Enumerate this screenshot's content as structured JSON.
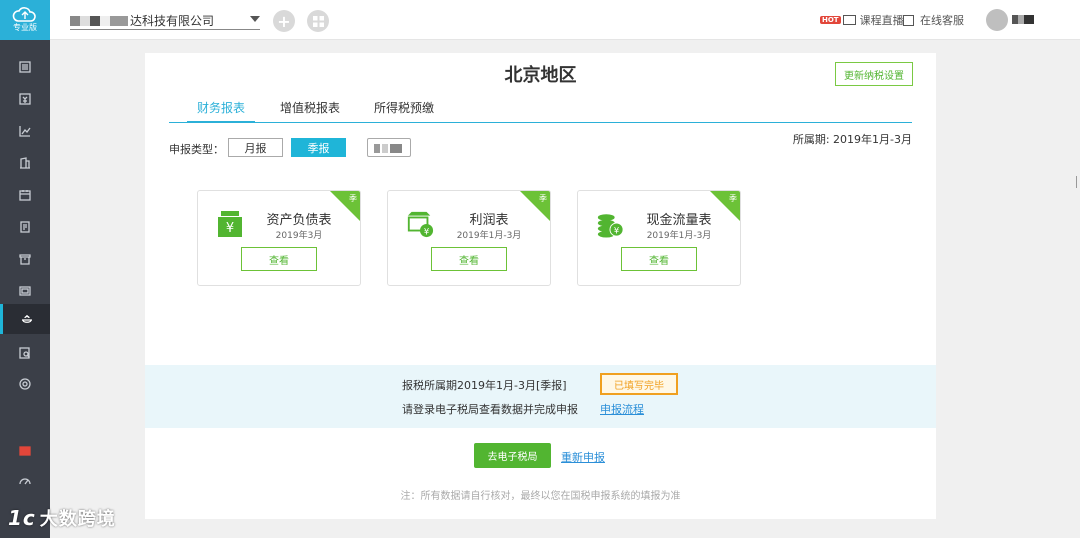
{
  "brand": {
    "edition": "专业版"
  },
  "sidebar": {
    "items": [
      {
        "icon": "ledger-icon"
      },
      {
        "icon": "voucher-icon"
      },
      {
        "icon": "chart-icon"
      },
      {
        "icon": "building-icon"
      },
      {
        "icon": "calendar-icon"
      },
      {
        "icon": "document-icon"
      },
      {
        "icon": "archive-icon"
      },
      {
        "icon": "report-icon"
      },
      {
        "icon": "tax-icon",
        "active": true
      },
      {
        "icon": "search-doc-icon"
      },
      {
        "icon": "settings-icon"
      },
      {
        "icon": "gift-icon"
      },
      {
        "icon": "speedometer-icon"
      }
    ]
  },
  "topbar": {
    "company": "达科技有限公司",
    "live_course": "课程直播",
    "hot_tag": "HOT",
    "online_service": "在线客服"
  },
  "main": {
    "region_title": "北京地区",
    "update_button": "更新纳税设置",
    "tabs": [
      {
        "label": "财务报表",
        "active": true
      },
      {
        "label": "增值税报表"
      },
      {
        "label": "所得税预缴"
      }
    ],
    "report_type_label": "申报类型：",
    "type_monthly": "月报",
    "type_quarterly": "季报",
    "period": "所属期: 2019年1月-3月",
    "cards": [
      {
        "name": "资产负债表",
        "date": "2019年3月",
        "corner": "季",
        "action": "查看",
        "icon": "yuan-bag-icon"
      },
      {
        "name": "利润表",
        "date": "2019年1月-3月",
        "corner": "季",
        "action": "查看",
        "icon": "shop-yuan-icon"
      },
      {
        "name": "现金流量表",
        "date": "2019年1月-3月",
        "corner": "季",
        "action": "查看",
        "icon": "coins-icon"
      }
    ],
    "info_line1": "报税所属期2019年1月-3月[季报]",
    "info_line2": "请登录电子税局查看数据并完成申报",
    "status": "已填写完毕",
    "flow_link": "申报流程",
    "go_button": "去电子税局",
    "redo_link": "重新申报",
    "note": "注：所有数据请自行核对，最终以您在国税申报系统的填报为准"
  },
  "watermark": {
    "logo": "1c",
    "text": "大数跨境"
  },
  "colors": {
    "accent": "#2bb0d8",
    "green": "#52b531",
    "sidebar": "#3b3f48",
    "warn": "#f0a020"
  }
}
